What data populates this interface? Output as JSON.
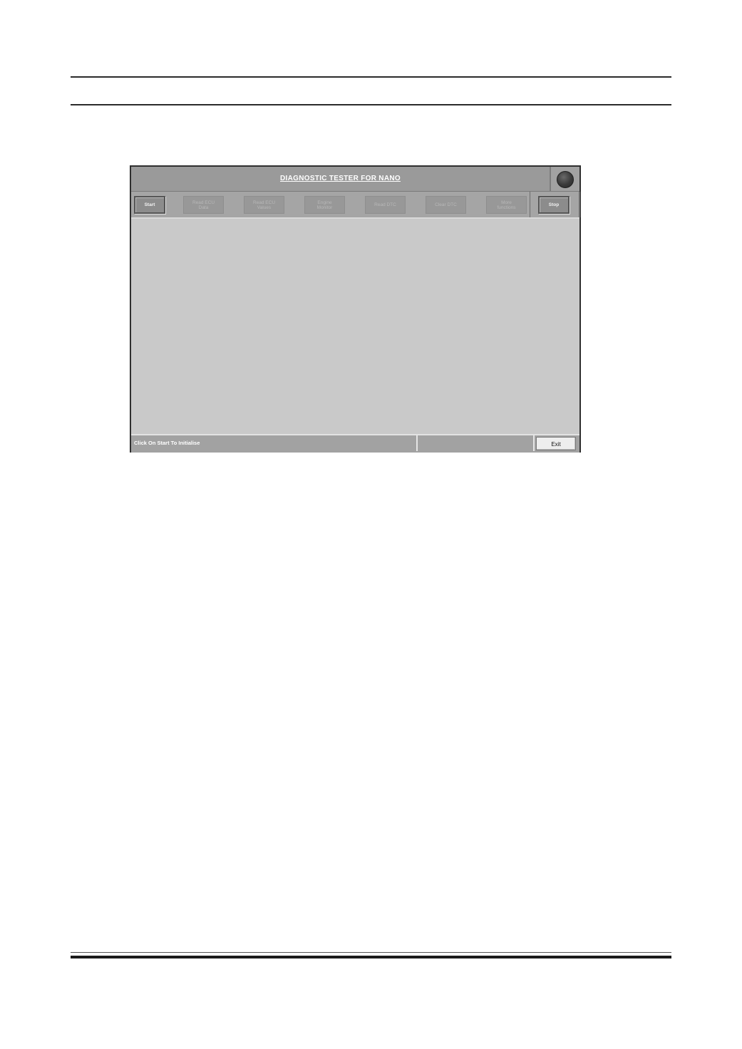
{
  "window": {
    "title": "DIAGNOSTIC TESTER  FOR NANO",
    "status_lamp": "indicator-lamp-off"
  },
  "toolbar": {
    "start": "Start",
    "read_ecu_data": "Read ECU\nData",
    "read_ecu_values": "Read ECU\nValues",
    "engine_monitor": "Engine\nMonitor",
    "read_dtc": "Read DTC",
    "clear_dtc": "Clear DTC",
    "more_functions": "More\nfunctions",
    "stop": "Stop"
  },
  "status_bar": {
    "message": "Click On Start To Initialise",
    "exit": "Exit"
  }
}
